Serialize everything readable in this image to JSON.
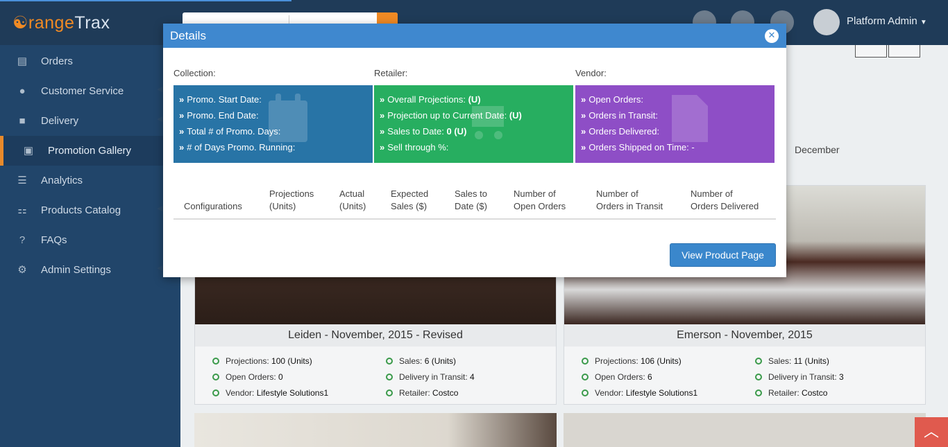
{
  "app": {
    "logo_main": "OrangeTrax",
    "user_name": "Platform Admin"
  },
  "sidebar": {
    "items": [
      {
        "label": "Orders",
        "icon": "document-icon"
      },
      {
        "label": "Customer Service",
        "icon": "users-icon"
      },
      {
        "label": "Delivery",
        "icon": "truck-icon"
      },
      {
        "label": "Promotion Gallery",
        "icon": "image-icon"
      },
      {
        "label": "Analytics",
        "icon": "list-icon"
      },
      {
        "label": "Products Catalog",
        "icon": "sitemap-icon"
      },
      {
        "label": "FAQs",
        "icon": "question-icon"
      },
      {
        "label": "Admin Settings",
        "icon": "gears-icon"
      }
    ]
  },
  "background": {
    "month": "December",
    "cards": [
      {
        "title": "Leiden - November, 2015 - Revised",
        "projections_label": "Projections:",
        "projections_value": "100 (Units)",
        "sales_label": "Sales:",
        "sales_value": "6 (Units)",
        "open_orders_label": "Open Orders:",
        "open_orders_value": "0",
        "transit_label": "Delivery in Transit:",
        "transit_value": "4",
        "vendor_label": "Vendor:",
        "vendor_value": "Lifestyle Solutions1",
        "retailer_label": "Retailer:",
        "retailer_value": "Costco"
      },
      {
        "title": "Emerson - November, 2015",
        "projections_label": "Projections:",
        "projections_value": "106 (Units)",
        "sales_label": "Sales:",
        "sales_value": "11 (Units)",
        "open_orders_label": "Open Orders:",
        "open_orders_value": "6",
        "transit_label": "Delivery in Transit:",
        "transit_value": "3",
        "vendor_label": "Vendor:",
        "vendor_value": "Lifestyle Solutions1",
        "retailer_label": "Retailer:",
        "retailer_value": "Costco"
      }
    ]
  },
  "modal": {
    "title": "Details",
    "collection_label": "Collection:",
    "retailer_label": "Retailer:",
    "vendor_label": "Vendor:",
    "collection_rows": [
      "Promo. Start Date:",
      "Promo. End Date:",
      "Total # of Promo. Days:",
      "# of Days Promo. Running:"
    ],
    "retailer_rows": [
      {
        "label": "Overall Projections:",
        "value": "(U)"
      },
      {
        "label": "Projection up to Current Date:",
        "value": "(U)"
      },
      {
        "label": "Sales to Date:",
        "value": "0 (U)"
      },
      {
        "label": "Sell through %:",
        "value": ""
      }
    ],
    "vendor_rows": [
      "Open Orders:",
      "Orders in Transit:",
      "Orders Delivered:",
      "Orders Shipped on Time: -"
    ],
    "table_headers": [
      {
        "line1": "",
        "line2": "Configurations"
      },
      {
        "line1": "Projections",
        "line2": "(Units)"
      },
      {
        "line1": "Actual",
        "line2": "(Units)"
      },
      {
        "line1": "Expected",
        "line2": "Sales ($)"
      },
      {
        "line1": "Sales to",
        "line2": "Date ($)"
      },
      {
        "line1": "Number of",
        "line2": "Open Orders"
      },
      {
        "line1": "Number of",
        "line2": "Orders in Transit"
      },
      {
        "line1": "Number of",
        "line2": "Orders Delivered"
      }
    ],
    "view_button": "View Product Page",
    "colors": {
      "collection": "#2874a6",
      "retailer": "#27ae60",
      "vendor": "#8e4ec6",
      "header": "#3f88cf"
    }
  }
}
